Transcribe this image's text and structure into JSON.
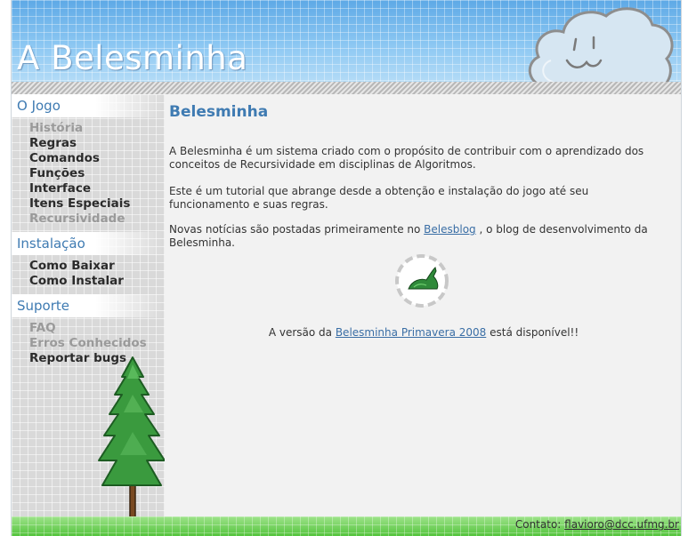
{
  "header": {
    "site_title": "A Belesminha"
  },
  "sidebar": {
    "sections": [
      {
        "title": "O Jogo",
        "items": [
          {
            "label": "História",
            "dim": true
          },
          {
            "label": "Regras",
            "dim": false
          },
          {
            "label": "Comandos",
            "dim": false
          },
          {
            "label": "Funções",
            "dim": false
          },
          {
            "label": "Interface",
            "dim": false
          },
          {
            "label": "Itens Especiais",
            "dim": false
          },
          {
            "label": "Recursividade",
            "dim": true
          }
        ]
      },
      {
        "title": "Instalação",
        "items": [
          {
            "label": "Como Baixar",
            "dim": false
          },
          {
            "label": "Como Instalar",
            "dim": false
          }
        ]
      },
      {
        "title": "Suporte",
        "items": [
          {
            "label": "FAQ",
            "dim": true
          },
          {
            "label": "Erros Conhecidos",
            "dim": true
          },
          {
            "label": "Reportar bugs",
            "dim": false
          }
        ]
      }
    ]
  },
  "main": {
    "heading": "Belesminha",
    "paragraph1": "A Belesminha é um sistema criado com o propósito de contribuir com o aprendizado dos conceitos de Recursividade em disciplinas de Algoritmos.",
    "paragraph2": "Este é um tutorial que abrange desde a obtenção e instalação do jogo até seu funcionamento e suas regras.",
    "news_prefix": "Novas notícias são postadas primeiramente no ",
    "news_link": "Belesblog",
    "news_suffix": " , o blog de desenvolvimento da Belesminha.",
    "notice_prefix": "A versão da ",
    "notice_link": "Belesminha Primavera 2008",
    "notice_suffix": " está disponível!!"
  },
  "footer": {
    "contact_label": "Contato: ",
    "contact_email": "flavioro@dcc.ufmg.br"
  },
  "colors": {
    "accent": "#3f7bb2",
    "header_sky": "#8cc8f2",
    "footer_grass": "#6fd25a",
    "tree_green": "#3a9a3e"
  },
  "icons": {
    "cloud": "smiling-cloud-icon",
    "tree": "pine-tree-icon",
    "loader": "belesminha-snail-icon"
  }
}
